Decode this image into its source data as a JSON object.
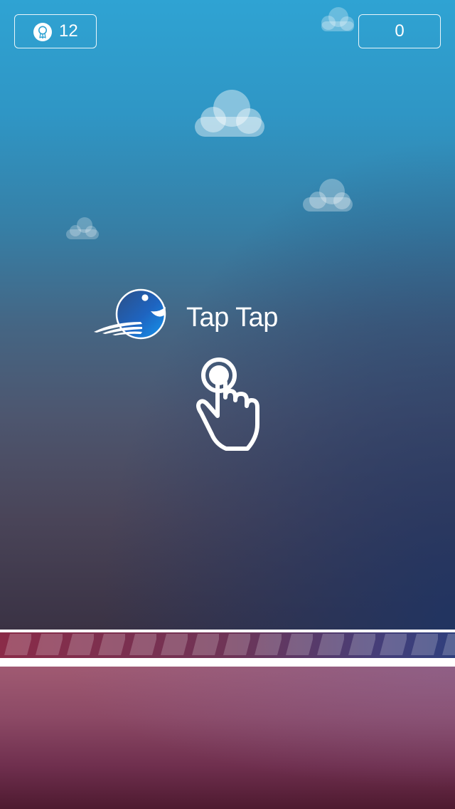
{
  "hud": {
    "best_score": "12",
    "best_icon": "award-ribbon-icon",
    "current_score": "0"
  },
  "prompt": {
    "text": "Tap Tap",
    "character_icon": "blue-bird-icon",
    "gesture_icon": "tap-hand-icon"
  },
  "colors": {
    "sky_top": "#2fa3d3",
    "sky_bottom": "#3a3244",
    "stripe_red": "#8a2b48",
    "stripe_blue": "#2f3f7c",
    "ground_top": "#a05a72",
    "ground_bottom": "#4e1a30",
    "bird_blue": "#1f6fd0"
  }
}
